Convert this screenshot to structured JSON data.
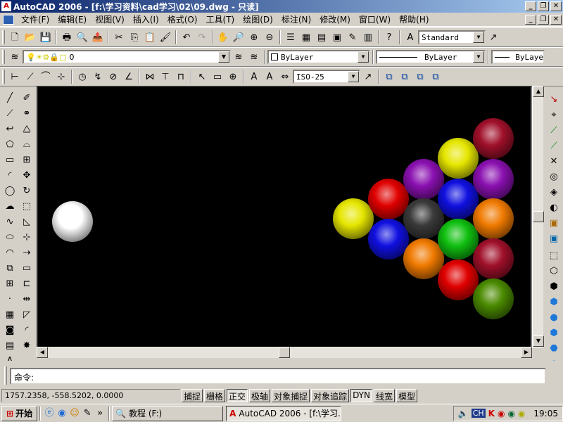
{
  "window": {
    "title": "AutoCAD 2006 - [f:\\学习资料\\cad学习\\02\\09.dwg - 只读]",
    "minimize": "_",
    "restore": "❐",
    "close": "✕"
  },
  "menu": {
    "items": [
      "文件(F)",
      "编辑(E)",
      "视图(V)",
      "插入(I)",
      "格式(O)",
      "工具(T)",
      "绘图(D)",
      "标注(N)",
      "修改(M)",
      "窗口(W)",
      "帮助(H)"
    ]
  },
  "toolbar": {
    "text_style": "Standard",
    "layer": "0",
    "color": "ByLayer",
    "linetype": "ByLayer",
    "lineweight": "ByLaye",
    "dim_style": "ISO-25"
  },
  "canvas": {
    "background": "#000000",
    "balls": [
      {
        "color": "white",
        "hex": "#ffffff"
      },
      {
        "color": "yellow",
        "hex": "#e6e600"
      },
      {
        "color": "red",
        "hex": "#e00000"
      },
      {
        "color": "blue",
        "hex": "#1010e0"
      },
      {
        "color": "purple",
        "hex": "#8a10b0"
      },
      {
        "color": "black",
        "hex": "#3a3a3a"
      },
      {
        "color": "orange",
        "hex": "#f07a00"
      },
      {
        "color": "yellow",
        "hex": "#e6e600"
      },
      {
        "color": "blue",
        "hex": "#1010e0"
      },
      {
        "color": "green",
        "hex": "#10c010"
      },
      {
        "color": "red",
        "hex": "#e00000"
      },
      {
        "color": "maroon",
        "hex": "#a0102a"
      },
      {
        "color": "purple",
        "hex": "#8a10b0"
      },
      {
        "color": "orange",
        "hex": "#f07a00"
      },
      {
        "color": "maroon",
        "hex": "#a0102a"
      },
      {
        "color": "olive-green",
        "hex": "#4a8a00"
      }
    ]
  },
  "command": {
    "prompt": "命令:"
  },
  "status": {
    "coordinates": "1757.2358,  -558.5202,  0.0000",
    "modes": [
      {
        "label": "捕捉",
        "on": false
      },
      {
        "label": "栅格",
        "on": false
      },
      {
        "label": "正交",
        "on": true
      },
      {
        "label": "极轴",
        "on": false
      },
      {
        "label": "对象捕捉",
        "on": false
      },
      {
        "label": "对象追踪",
        "on": false
      },
      {
        "label": "DYN",
        "on": true
      },
      {
        "label": "线宽",
        "on": false
      },
      {
        "label": "模型",
        "on": false
      }
    ]
  },
  "taskbar": {
    "start": "开始",
    "tasks": [
      {
        "label": "教程 (F:)",
        "active": false
      },
      {
        "label": "AutoCAD 2006 - [f:\\学习...",
        "active": true
      }
    ],
    "tray_lang": "CH",
    "clock": "19:05"
  }
}
